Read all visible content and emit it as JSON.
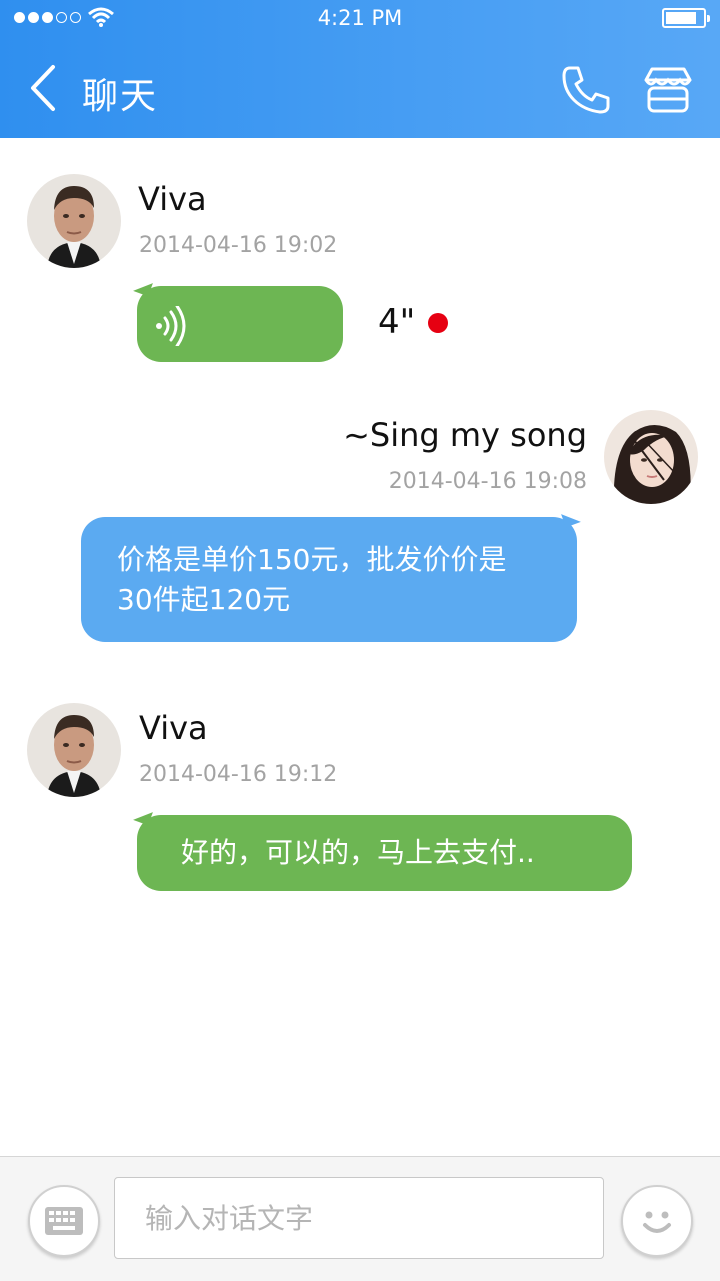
{
  "status_bar": {
    "time": "4:21 PM"
  },
  "header": {
    "title": "聊天"
  },
  "messages": [
    {
      "sender": "Viva",
      "timestamp": "2014-04-16 19:02",
      "type": "voice",
      "duration": "4\"",
      "unread": true
    },
    {
      "sender": "~Sing my song",
      "timestamp": "2014-04-16 19:08",
      "type": "text",
      "text_line1": "价格是单价150元，批发价价是",
      "text_line2": "30件起120元"
    },
    {
      "sender": "Viva",
      "timestamp": "2014-04-16 19:12",
      "type": "text",
      "text": "好的，可以的，马上去支付.."
    }
  ],
  "input": {
    "placeholder": "输入对话文字"
  },
  "colors": {
    "header": "#2f8fef",
    "green_bubble": "#6db653",
    "blue_bubble": "#5baaf1",
    "unread": "#e60012"
  }
}
